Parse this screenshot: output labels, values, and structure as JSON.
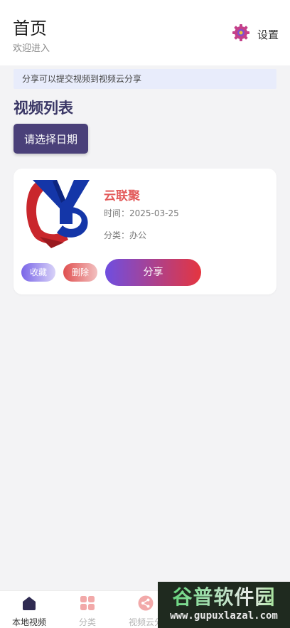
{
  "header": {
    "title": "首页",
    "subtitle": "欢迎进入",
    "settings_label": "设置"
  },
  "notice": "分享可以提交视频到视频云分享",
  "section_title": "视频列表",
  "date_button_label": "请选择日期",
  "video_card": {
    "name": "云联聚",
    "time": "时间：2025-03-25",
    "category": "分类：办公",
    "favorite_label": "收藏",
    "delete_label": "删除",
    "share_label": "分享"
  },
  "tabbar": {
    "items": [
      {
        "label": "本地视频",
        "icon": "home-icon",
        "active": true
      },
      {
        "label": "分类",
        "icon": "grid-icon",
        "active": false
      },
      {
        "label": "视频云分",
        "icon": "share-icon",
        "active": false
      }
    ]
  },
  "watermark": {
    "title": "谷普软件园",
    "url": "www.gupuxlazal.com"
  },
  "colors": {
    "accent": "#4a4079",
    "video_name": "#e35a5a",
    "share_gradient_start": "#6f4ee0",
    "share_gradient_end": "#e5353f",
    "notice_bg": "#e8ecfb"
  }
}
